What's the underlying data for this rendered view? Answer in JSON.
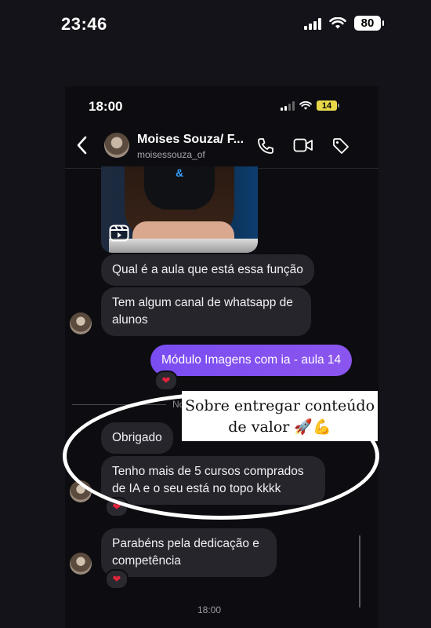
{
  "outer_status": {
    "time": "23:46",
    "battery": "80"
  },
  "inner_status": {
    "time": "18:00",
    "battery": "14"
  },
  "header": {
    "contact_name": "Moises Souza/ F...",
    "contact_username": "moisessouza_of"
  },
  "messages": [
    {
      "text": "Qual é a aula que está essa função"
    },
    {
      "text": "Tem algum canal de whatsapp de alunos"
    },
    {
      "text": "Módulo Imagens com ia - aula 14",
      "reaction": "❤"
    },
    {
      "text": "Obrigado"
    },
    {
      "text": "Tenho mais de 5 cursos comprados de IA e o seu está no topo kkkk",
      "reaction": "❤"
    },
    {
      "text": "Parabéns pela dedicação e competência",
      "reaction": "❤"
    }
  ],
  "separator_text": "No",
  "caption": {
    "text": "Sobre entregar conteúdo de valor 🚀💪"
  },
  "bottom_time": "18:00"
}
